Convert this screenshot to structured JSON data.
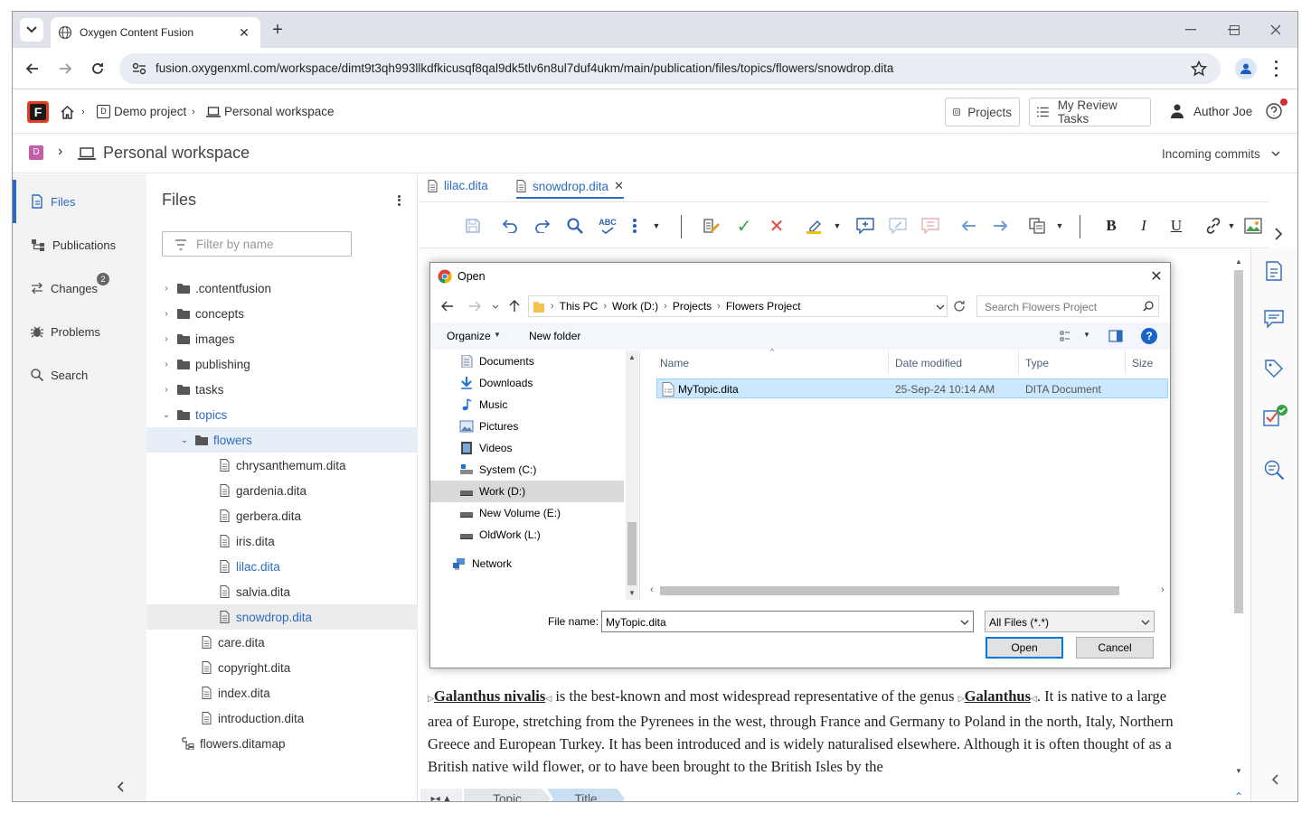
{
  "browser": {
    "tab_title": "Oxygen Content Fusion",
    "url": "fusion.oxygenxml.com/workspace/dimt9t3qh993llkdfkicusqf8qal9dk5tlv6n8ul7duf4ukm/main/publication/files/topics/flowers/snowdrop.dita"
  },
  "header": {
    "breadcrumb": [
      "Demo project",
      "Personal workspace"
    ],
    "projects_label": "Projects",
    "review_label": "My Review Tasks",
    "user_label": "Author Joe"
  },
  "workspace": {
    "badge": "D",
    "title": "Personal workspace",
    "incoming": "Incoming commits"
  },
  "leftnav": {
    "items": [
      {
        "label": "Files",
        "icon": "files-icon"
      },
      {
        "label": "Publications",
        "icon": "publications-icon"
      },
      {
        "label": "Changes",
        "icon": "changes-icon",
        "badge": "2"
      },
      {
        "label": "Problems",
        "icon": "bug-icon"
      },
      {
        "label": "Search",
        "icon": "search-icon"
      }
    ]
  },
  "files": {
    "title": "Files",
    "filter_placeholder": "Filter by name",
    "tree": [
      {
        "label": ".contentfusion",
        "type": "folder"
      },
      {
        "label": "concepts",
        "type": "folder"
      },
      {
        "label": "images",
        "type": "folder"
      },
      {
        "label": "publishing",
        "type": "folder"
      },
      {
        "label": "tasks",
        "type": "folder"
      },
      {
        "label": "topics",
        "type": "folder"
      },
      {
        "label": "flowers",
        "type": "folder"
      },
      {
        "label": "chrysanthemum.dita",
        "type": "file"
      },
      {
        "label": "gardenia.dita",
        "type": "file"
      },
      {
        "label": "gerbera.dita",
        "type": "file"
      },
      {
        "label": "iris.dita",
        "type": "file"
      },
      {
        "label": "lilac.dita",
        "type": "file"
      },
      {
        "label": "salvia.dita",
        "type": "file"
      },
      {
        "label": "snowdrop.dita",
        "type": "file"
      },
      {
        "label": "care.dita",
        "type": "file"
      },
      {
        "label": "copyright.dita",
        "type": "file"
      },
      {
        "label": "index.dita",
        "type": "file"
      },
      {
        "label": "introduction.dita",
        "type": "file"
      },
      {
        "label": "flowers.ditamap",
        "type": "map"
      }
    ]
  },
  "editor": {
    "tabs": [
      "lilac.dita",
      "snowdrop.dita"
    ],
    "bold": "B",
    "italic": "I",
    "underline": "U",
    "content": {
      "term1": "Galanthus nivalis",
      "text1": " is the best-known and most widespread representative of the genus ",
      "term2": "Galanthus",
      "text2": ". It is native to a large area of Europe, stretching from the Pyrenees in the west, through France and Germany to Poland in the north, Italy, Northern Greece and European Turkey. It has been introduced and is widely naturalised elsewhere. Although it is often thought of as a British native wild flower, or to have been brought to the British Isles by the"
    },
    "breadcrumb": [
      "Topic",
      "Title"
    ]
  },
  "dialog": {
    "title": "Open",
    "path": [
      "This PC",
      "Work (D:)",
      "Projects",
      "Flowers Project"
    ],
    "search_placeholder": "Search Flowers Project",
    "organize": "Organize",
    "new_folder": "New folder",
    "help": "?",
    "nav": [
      {
        "label": "Documents",
        "icon": "documents-icon"
      },
      {
        "label": "Downloads",
        "icon": "downloads-icon"
      },
      {
        "label": "Music",
        "icon": "music-icon"
      },
      {
        "label": "Pictures",
        "icon": "pictures-icon"
      },
      {
        "label": "Videos",
        "icon": "videos-icon"
      },
      {
        "label": "System (C:)",
        "icon": "drive-icon"
      },
      {
        "label": "Work (D:)",
        "icon": "drive-icon"
      },
      {
        "label": "New Volume (E:)",
        "icon": "drive-icon"
      },
      {
        "label": "OldWork (L:)",
        "icon": "drive-icon"
      },
      {
        "label": "Network",
        "icon": "network-icon"
      }
    ],
    "columns": [
      "Name",
      "Date modified",
      "Type",
      "Size"
    ],
    "file": {
      "name": "MyTopic.dita",
      "date": "25-Sep-24 10:14 AM",
      "type": "DITA Document"
    },
    "filename_label": "File name:",
    "filename_value": "MyTopic.dita",
    "filetype": "All Files (*.*)",
    "open_label": "Open",
    "cancel_label": "Cancel"
  }
}
